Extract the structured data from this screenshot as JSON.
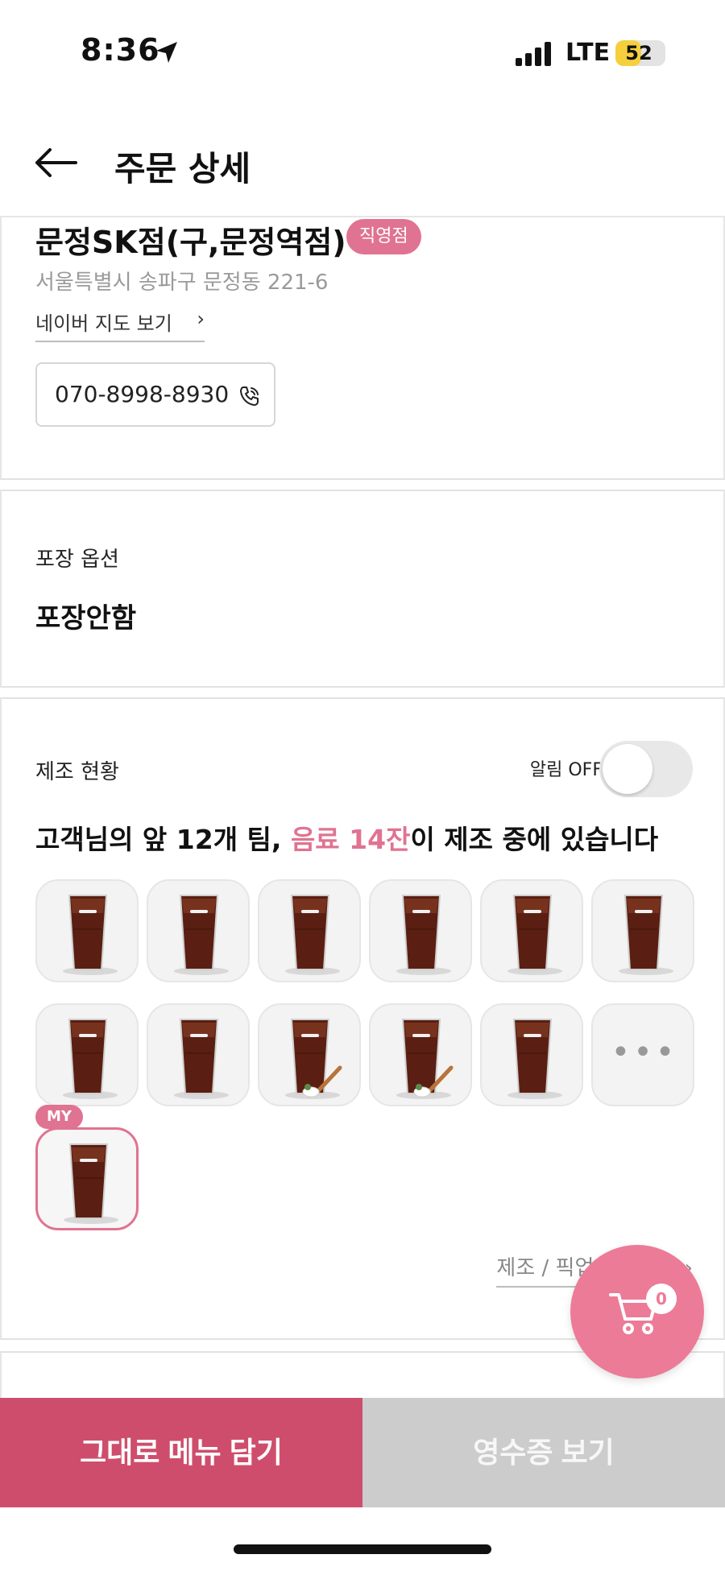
{
  "status_bar": {
    "time": "8:36",
    "network": "LTE",
    "battery": "52",
    "battery_level": 0.52,
    "icons": [
      "location-arrow-icon",
      "signal-bars-icon",
      "battery-icon"
    ]
  },
  "header": {
    "title": "주문 상세",
    "back_icon": "arrow-left-icon"
  },
  "store": {
    "name": "문정SK점(구,문정역점)",
    "badge": "직영점",
    "address": "서울특별시 송파구 문정동 221-6",
    "map_link": "네이버 지도 보기",
    "phone": "070-8998-8930",
    "phone_icon": "phone-call-icon"
  },
  "packaging": {
    "label": "포장 옵션",
    "value": "포장안함"
  },
  "production": {
    "label": "제조 현황",
    "alert_label": "알림 OFF",
    "alert_on": false,
    "message_before": "고객님의 앞 12개 팀, ",
    "message_highlight": "음료 14잔",
    "message_after": "이 제조 중에 있습니다",
    "queue_items": [
      "iced-americano",
      "iced-americano",
      "iced-americano",
      "iced-americano",
      "iced-americano",
      "iced-americano",
      "iced-americano",
      "iced-americano",
      "iced-americano-with-salt",
      "iced-americano-with-salt",
      "iced-americano",
      "more"
    ],
    "my_badge": "MY",
    "my_item": "iced-americano",
    "schedule_link": "제조 / 픽업 예정시간"
  },
  "cart": {
    "count": "0",
    "icon": "shopping-cart-icon"
  },
  "buttons": {
    "reorder": "그대로 메뉴 담기",
    "receipt": "영수증 보기"
  },
  "colors": {
    "accent": "#e07391",
    "primary_button": "#cf4d6c",
    "secondary_button": "#cccccc",
    "cart_fab": "#ec7b98"
  }
}
